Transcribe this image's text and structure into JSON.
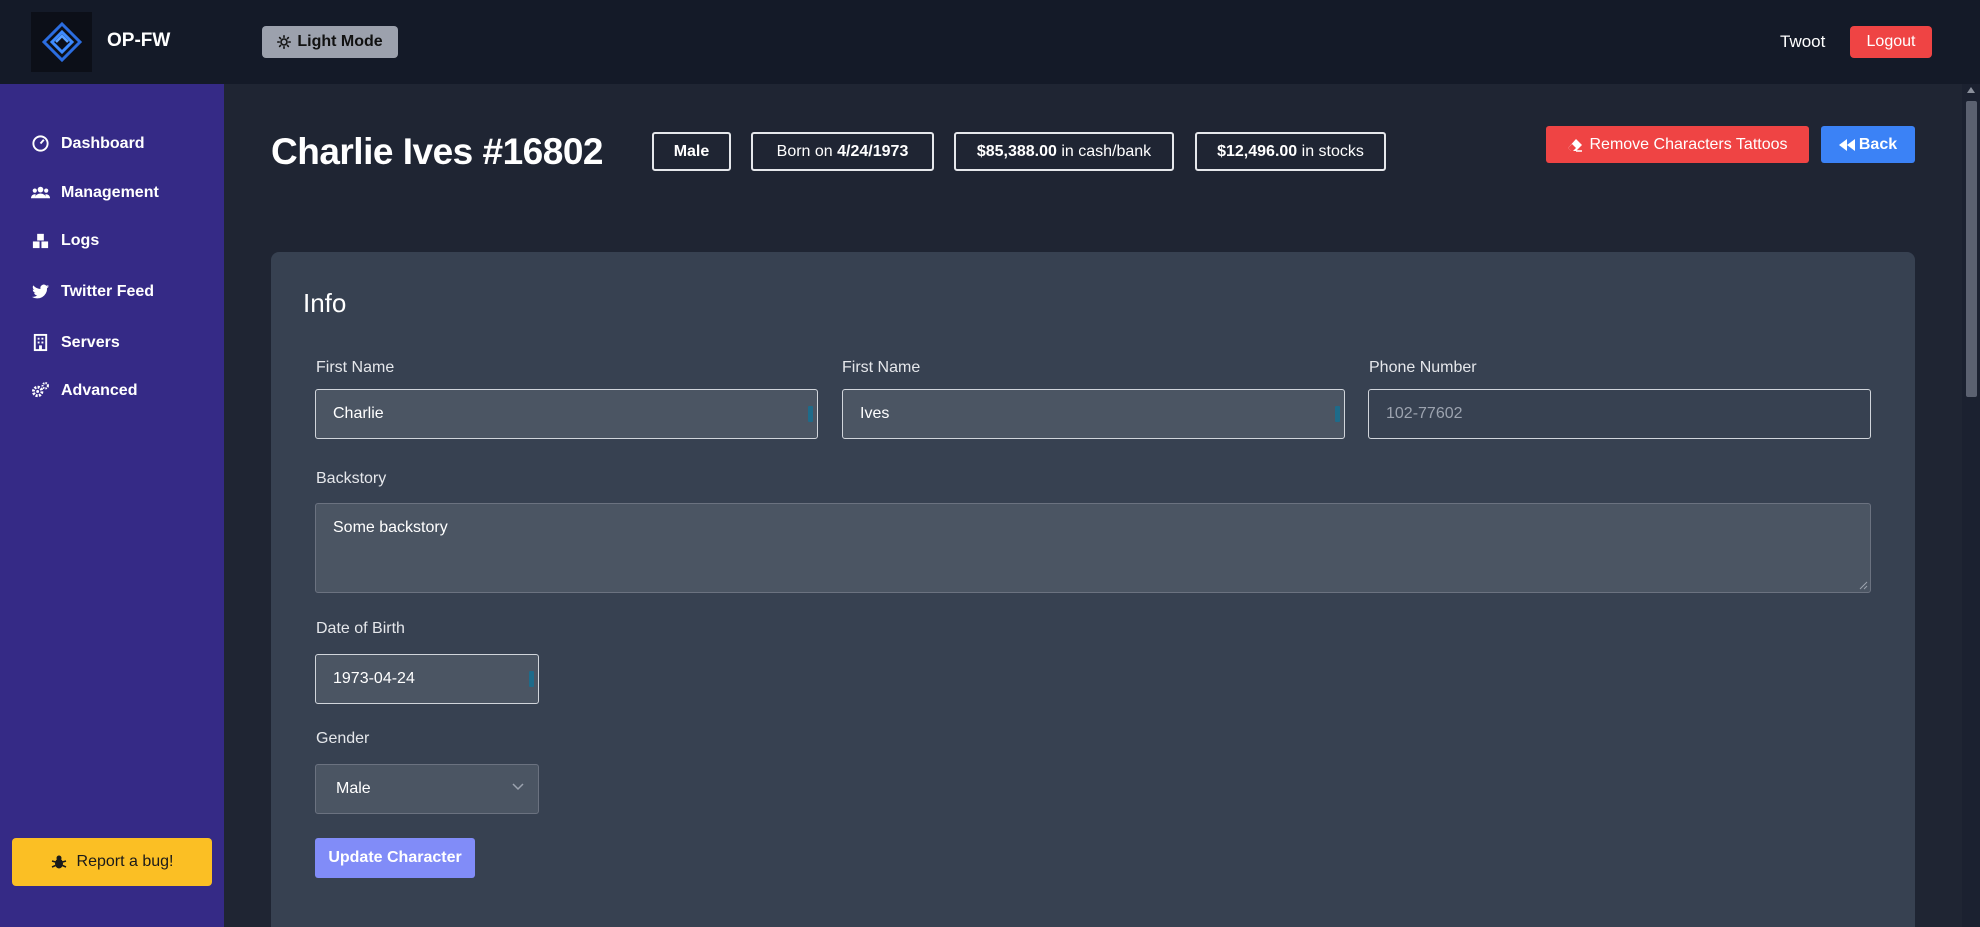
{
  "topbar": {
    "brand": "OP-FW",
    "mode_button": "Light Mode",
    "user": "Twoot",
    "logout": "Logout"
  },
  "sidebar": {
    "items": [
      {
        "label": "Dashboard",
        "icon": "gauge-icon"
      },
      {
        "label": "Management",
        "icon": "users-icon"
      },
      {
        "label": "Logs",
        "icon": "boxes-icon"
      },
      {
        "label": "Twitter Feed",
        "icon": "twitter-icon"
      },
      {
        "label": "Servers",
        "icon": "building-icon"
      },
      {
        "label": "Advanced",
        "icon": "cogs-icon"
      }
    ],
    "report_bug": "Report a bug!"
  },
  "header": {
    "title": "Charlie Ives #16802",
    "gender_chip": "Male",
    "born_prefix": "Born on",
    "born_value": "4/24/1973",
    "cash_value": "$85,388.00",
    "cash_suffix": "in cash/bank",
    "stocks_value": "$12,496.00",
    "stocks_suffix": "in stocks",
    "remove_tattoos": "Remove Characters Tattoos",
    "back": "Back"
  },
  "info": {
    "title": "Info",
    "first_name_label": "First Name",
    "first_name_value": "Charlie",
    "last_name_label": "First Name",
    "last_name_value": "Ives",
    "phone_label": "Phone Number",
    "phone_placeholder": "102-77602",
    "backstory_label": "Backstory",
    "backstory_value": "Some backstory",
    "dob_label": "Date of Birth",
    "dob_value": "1973-04-24",
    "gender_label": "Gender",
    "gender_value": "Male",
    "update_button": "Update Character"
  },
  "colors": {
    "topbar": "#141a28",
    "sidebar": "#352a86",
    "main_bg": "#1f2533",
    "card": "#374151",
    "danger": "#ef4444",
    "primary": "#3b82f6",
    "warning": "#fbbf24",
    "indigo": "#818cf8"
  }
}
